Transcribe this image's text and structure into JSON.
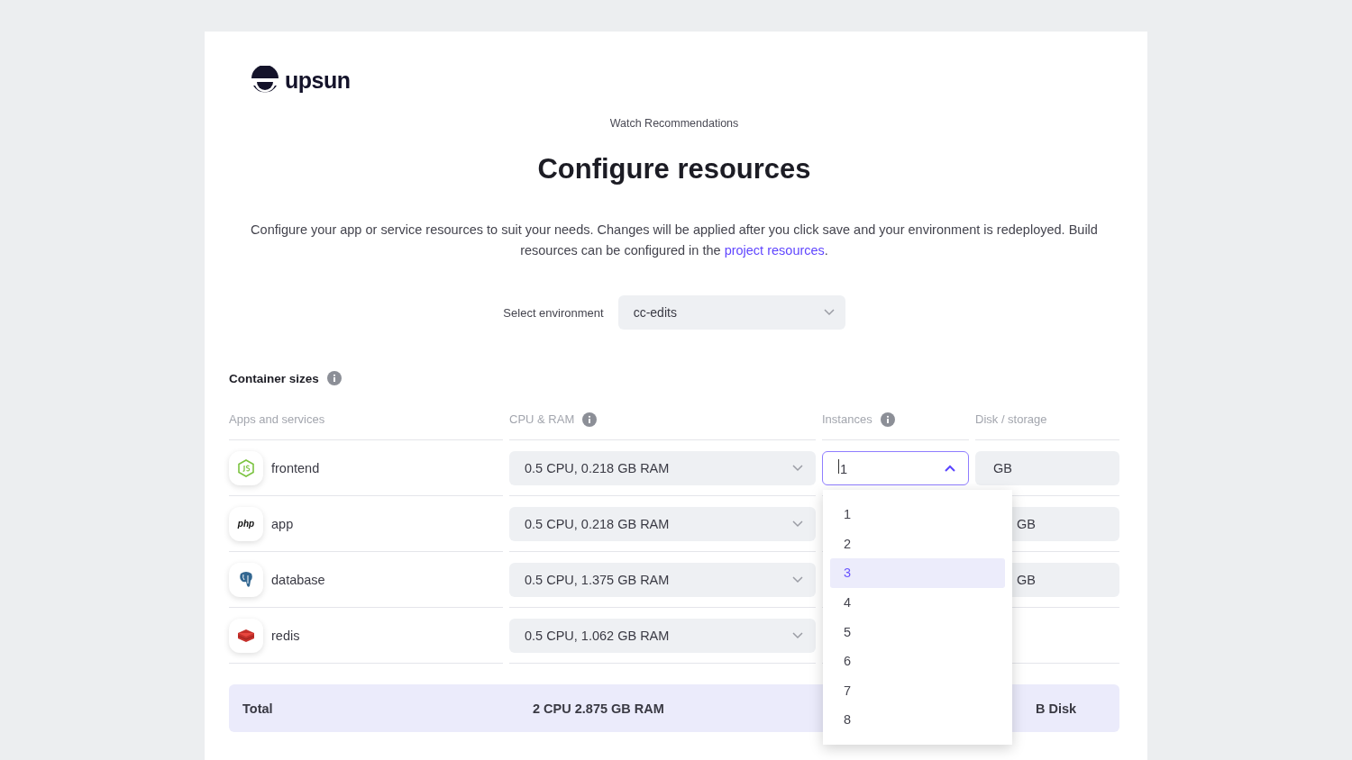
{
  "logo": {
    "text": "upsun"
  },
  "breadcrumb": "Watch Recommendations",
  "title": "Configure resources",
  "description": {
    "text": "Configure your app or service resources to suit your needs. Changes will be applied after you click save and your environment is redeployed. Build resources can be configured in the ",
    "link": "project resources",
    "suffix": "."
  },
  "environment": {
    "label": "Select environment",
    "value": "cc-edits"
  },
  "section": {
    "title": "Container sizes",
    "info": true
  },
  "table": {
    "columns": [
      {
        "label": "Apps and services",
        "info": false
      },
      {
        "label": "CPU & RAM",
        "info": true
      },
      {
        "label": "Instances",
        "info": true
      },
      {
        "label": "Disk / storage",
        "info": false
      }
    ],
    "rows": [
      {
        "name": "frontend",
        "kind": "nodejs",
        "cpu_ram": "0.5 CPU, 0.218 GB RAM",
        "instances": "1",
        "disk": "GB"
      },
      {
        "name": "app",
        "kind": "php",
        "logo_text": "php",
        "cpu_ram": "0.5 CPU, 0.218 GB RAM",
        "disk": "GB"
      },
      {
        "name": "database",
        "kind": "postgresql",
        "cpu_ram": "0.5 CPU, 1.375 GB RAM",
        "disk": "GB"
      },
      {
        "name": "redis",
        "kind": "redis",
        "cpu_ram": "0.5 CPU, 1.062 GB RAM"
      }
    ],
    "total": {
      "label": "Total",
      "cpu_ram": "2 CPU 2.875 GB RAM",
      "disk": "B Disk"
    }
  },
  "instances_dropdown": {
    "expanded": true,
    "options": [
      {
        "label": "1",
        "selected": false
      },
      {
        "label": "2",
        "selected": false
      },
      {
        "label": "3",
        "selected": true
      },
      {
        "label": "4",
        "selected": false
      },
      {
        "label": "5",
        "selected": false
      },
      {
        "label": "6",
        "selected": false
      },
      {
        "label": "7",
        "selected": false
      },
      {
        "label": "8",
        "selected": false
      }
    ]
  }
}
